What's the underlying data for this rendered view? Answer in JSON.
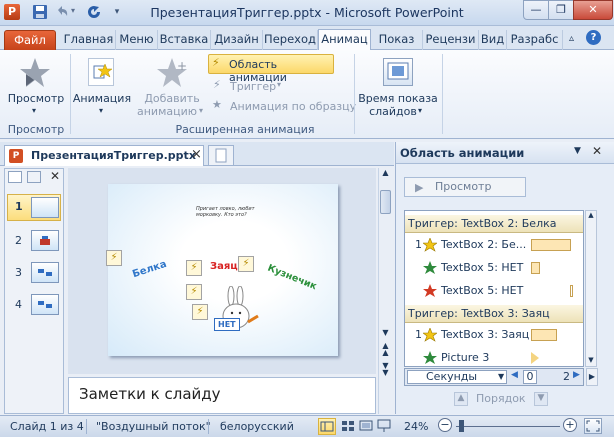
{
  "window": {
    "title": "ПрезентацияТриггер.pptx - Microsoft PowerPoint",
    "app_icon": "P",
    "minimize": "—",
    "restore": "❐",
    "close": "✕"
  },
  "tabs": [
    {
      "label": "Файл"
    },
    {
      "label": "Главная"
    },
    {
      "label": "Меню"
    },
    {
      "label": "Вставка"
    },
    {
      "label": "Дизайн"
    },
    {
      "label": "Переход"
    },
    {
      "label": "Анимац"
    },
    {
      "label": "Показ сл"
    },
    {
      "label": "Рецензи"
    },
    {
      "label": "Вид"
    },
    {
      "label": "Разрабс"
    }
  ],
  "ribbon": {
    "preview_btn": "Просмотр",
    "preview_group": "Просмотр",
    "animation_btn": "Анимация",
    "add_animation_l1": "Добавить",
    "add_animation_l2": "анимацию",
    "anim_pane_btn": "Область анимации",
    "trigger_btn": "Триггер",
    "anim_painter_btn": "Анимация по образцу",
    "adv_group": "Расширенная анимация",
    "timing_l1": "Время показа",
    "timing_l2": "слайдов"
  },
  "doc_tab": {
    "label": "ПрезентацияТриггер.pptx",
    "close": "×"
  },
  "slides": [
    {
      "num": "1"
    },
    {
      "num": "2"
    },
    {
      "num": "3"
    },
    {
      "num": "4"
    }
  ],
  "slide_content": {
    "belka": "Белка",
    "zayac": "Заяц",
    "kuznechik": "Кузнечик",
    "question": "Пригает ловко, любит морковку. Кто это?",
    "net": "НЕТ"
  },
  "notes": {
    "placeholder": "Заметки к слайду"
  },
  "anim_pane": {
    "title": "Область анимации",
    "play": "Просмотр",
    "triggers": [
      {
        "header": "Триггер: TextBox 2: Белка",
        "items": [
          {
            "num": "1",
            "name": "TextBox 2: Бе..."
          },
          {
            "num": "",
            "name": "TextBox 5: НЕТ"
          },
          {
            "num": "",
            "name": "TextBox 5: НЕТ"
          }
        ]
      },
      {
        "header": "Триггер: TextBox 3: Заяц",
        "items": [
          {
            "num": "1",
            "name": "TextBox 3: Заяц"
          },
          {
            "num": "",
            "name": "Picture 3"
          }
        ]
      }
    ],
    "timeline_unit": "Секунды",
    "timeline_start": "0",
    "timeline_end": "2",
    "reorder": "Порядок"
  },
  "status": {
    "slide": "Слайд 1 из 4",
    "theme": "\"Воздушный поток\"",
    "lang": "белорусский",
    "zoom": "24%"
  },
  "colors": {
    "file_tab": "#d24f23",
    "green_star": "#2f8a3c",
    "yellow_star": "#f2c414",
    "red_star": "#d23a23",
    "belka_text": "#2f76c9",
    "zayac_text": "#d82222",
    "kuznechik_text": "#2b8f3b"
  }
}
